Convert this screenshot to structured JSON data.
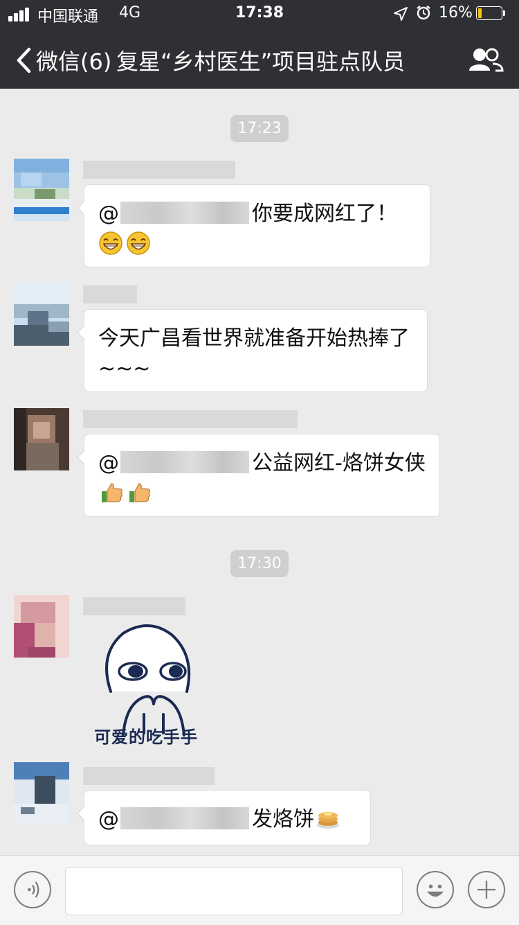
{
  "status_bar": {
    "carrier": "中国联通",
    "network": "4G",
    "time": "17:38",
    "battery_percent": "16%",
    "battery_level": 0.16,
    "icons": [
      "signal-icon",
      "location-arrow-icon",
      "alarm-clock-icon",
      "battery-icon"
    ]
  },
  "nav": {
    "back_label": "微信(6)",
    "title": "复星“乡村医生”项目驻点队员",
    "icons": [
      "chevron-left-icon",
      "group-members-icon"
    ]
  },
  "colors": {
    "nav_bg": "#2e3033",
    "chat_bg": "#ebebeb",
    "timestamp_bg": "#cfcfcf",
    "bubble_bg": "#ffffff",
    "battery_fill": "#f2c80f"
  },
  "chat": {
    "timestamps": [
      "17:23",
      "17:30"
    ],
    "messages": [
      {
        "prefix": "@",
        "text": "你要成网红了！",
        "second_line_emojis": [
          "grin-emoji",
          "grin-emoji"
        ]
      },
      {
        "text": "今天广昌看世界就准备开始热捧了~~~"
      },
      {
        "prefix": "@",
        "text": "公益网红-烙饼女侠",
        "emojis": [
          "thumbs-up-emoji",
          "thumbs-up-emoji"
        ]
      },
      {
        "sticker_caption": "可爱的吃手手"
      },
      {
        "prefix": "@",
        "text": "发烙饼",
        "emojis": [
          "pancakes-emoji"
        ]
      }
    ]
  },
  "input_bar": {
    "placeholder": "",
    "icons": [
      "voice-icon",
      "emoji-face-icon",
      "plus-icon"
    ]
  }
}
